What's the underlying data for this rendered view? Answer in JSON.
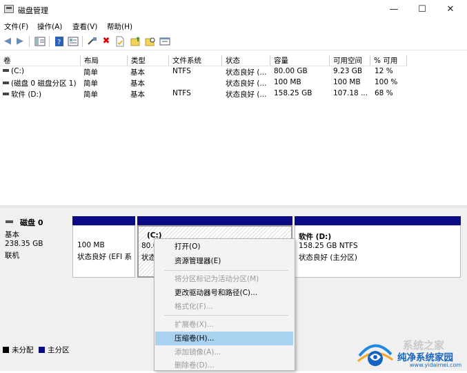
{
  "window": {
    "title": "磁盘管理",
    "minimize": "—",
    "maximize": "☐",
    "close": "✕"
  },
  "menu": [
    {
      "label": "文件(F)"
    },
    {
      "label": "操作(A)"
    },
    {
      "label": "查看(V)"
    },
    {
      "label": "帮助(H)"
    }
  ],
  "toolbar": {
    "icons": [
      "back-arrow-icon",
      "forward-arrow-icon",
      "console-tree-icon",
      "help-icon",
      "properties-icon",
      "connect-icon",
      "delete-icon",
      "doc-icon",
      "folder-up-icon",
      "folder-search-icon",
      "window-icon"
    ],
    "delete_color": "#d40000"
  },
  "table": {
    "headers": [
      "卷",
      "布局",
      "类型",
      "文件系统",
      "状态",
      "容量",
      "可用空间",
      "% 可用"
    ],
    "rows": [
      [
        "(C:)",
        "简单",
        "基本",
        "NTFS",
        "状态良好 (...",
        "80.00 GB",
        "9.23 GB",
        "12 %"
      ],
      [
        "(磁盘 0 磁盘分区 1)",
        "简单",
        "基本",
        "",
        "状态良好 (...",
        "100 MB",
        "100 MB",
        "100 %"
      ],
      [
        "软件 (D:)",
        "简单",
        "基本",
        "NTFS",
        "状态良好 (...",
        "158.25 GB",
        "107.18 ...",
        "68 %"
      ]
    ]
  },
  "disk": {
    "name": "磁盘 0",
    "type": "基本",
    "size": "238.35 GB",
    "status": "联机",
    "partitions": [
      {
        "size": "100 MB",
        "status": "状态良好 (EFI 系"
      },
      {
        "name": "(C:)",
        "size": "80.0",
        "status": "状态"
      },
      {
        "name": "软件  (D:)",
        "size": "158.25 GB NTFS",
        "status": "状态良好 (主分区)"
      }
    ],
    "bar_color": "#0a0a84"
  },
  "legend": {
    "unallocated": "未分配",
    "primary": "主分区",
    "primary_color": "#0a0a84",
    "unallocated_color": "#000000"
  },
  "context_menu": {
    "items": [
      {
        "label": "打开(O)",
        "enabled": true
      },
      {
        "label": "资源管理器(E)",
        "enabled": true
      },
      {
        "label": "将分区标记为活动分区(M)",
        "enabled": false
      },
      {
        "label": "更改驱动器号和路径(C)...",
        "enabled": true
      },
      {
        "label": "格式化(F)...",
        "enabled": false
      },
      {
        "label": "扩展卷(X)...",
        "enabled": false
      },
      {
        "label": "压缩卷(H)...",
        "enabled": true,
        "highlighted": true
      },
      {
        "label": "添加镜像(A)...",
        "enabled": false
      },
      {
        "label": "删除卷(D)...",
        "enabled": false
      }
    ]
  },
  "watermark": {
    "line1": "系统之家",
    "line2": "纯净系统家园",
    "line3": "www.yidaimei.com"
  }
}
